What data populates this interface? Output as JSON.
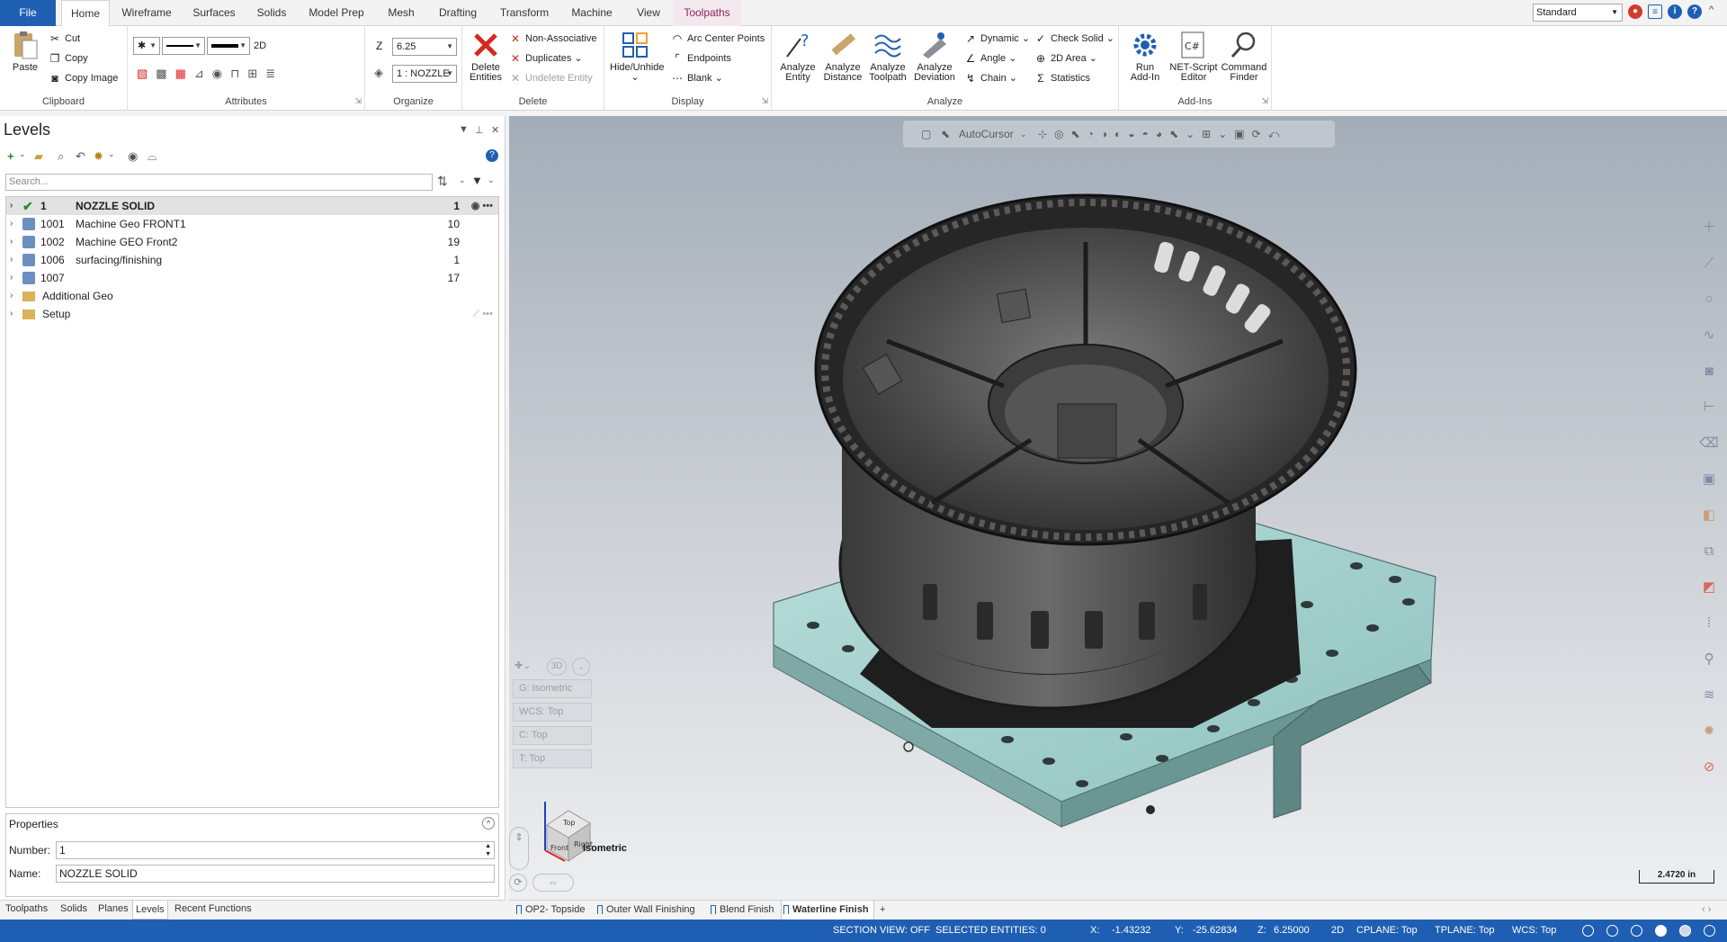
{
  "tabs": {
    "file": "File",
    "home": "Home",
    "wireframe": "Wireframe",
    "surfaces": "Surfaces",
    "solids": "Solids",
    "model_prep": "Model Prep",
    "mesh": "Mesh",
    "drafting": "Drafting",
    "transform": "Transform",
    "machine": "Machine",
    "view": "View",
    "toolpaths": "Toolpaths"
  },
  "workspace": "Standard",
  "clipboard": {
    "paste": "Paste",
    "cut": "Cut",
    "copy": "Copy",
    "copy_image": "Copy Image",
    "label": "Clipboard"
  },
  "attributes": {
    "mode_2d": "2D",
    "label": "Attributes"
  },
  "organize": {
    "z_label": "Z",
    "z_value": "6.25",
    "level_value": "1 : NOZZLE",
    "label": "Organize"
  },
  "delete_group": {
    "delete_entities_1": "Delete",
    "delete_entities_2": "Entities",
    "non_associative": "Non-Associative",
    "duplicates": "Duplicates",
    "undelete_entity": "Undelete Entity",
    "label": "Delete"
  },
  "display": {
    "hide_unhide_1": "Hide/Unhide",
    "arc_center_points": "Arc Center Points",
    "endpoints": "Endpoints",
    "blank": "Blank",
    "label": "Display"
  },
  "analyze": {
    "analyze_entity_1": "Analyze",
    "analyze_entity_2": "Entity",
    "analyze_distance_1": "Analyze",
    "analyze_distance_2": "Distance",
    "analyze_toolpath_1": "Analyze",
    "analyze_toolpath_2": "Toolpath",
    "analyze_deviation_1": "Analyze",
    "analyze_deviation_2": "Deviation",
    "dynamic": "Dynamic",
    "angle": "Angle",
    "chain": "Chain",
    "check_solid": "Check Solid",
    "area_2d": "2D Area",
    "statistics": "Statistics",
    "label": "Analyze"
  },
  "addins": {
    "run_addin_1": "Run",
    "run_addin_2": "Add-In",
    "net_script_1": "NET-Script",
    "net_script_2": "Editor",
    "command_finder_1": "Command",
    "command_finder_2": "Finder",
    "label": "Add-Ins"
  },
  "levels": {
    "title": "Levels",
    "search_placeholder": "Search...",
    "rows": [
      {
        "num": "1",
        "name": "NOZZLE SOLID",
        "count": "1"
      },
      {
        "num": "1001",
        "name": "Machine Geo FRONT1",
        "count": "10"
      },
      {
        "num": "1002",
        "name": "Machine GEO Front2",
        "count": "19"
      },
      {
        "num": "1006",
        "name": "surfacing/finishing",
        "count": "1"
      },
      {
        "num": "1007",
        "name": "",
        "count": "17"
      },
      {
        "num": "",
        "name": "Additional Geo",
        "count": ""
      },
      {
        "num": "",
        "name": "Setup",
        "count": ""
      }
    ]
  },
  "properties": {
    "title": "Properties",
    "number_label": "Number:",
    "number_value": "1",
    "name_label": "Name:",
    "name_value": "NOZZLE SOLID"
  },
  "panel_tabs": [
    "Toolpaths",
    "Solids",
    "Planes",
    "Levels",
    "Recent Functions"
  ],
  "viewport": {
    "autocursor": "AutoCursor",
    "qv_3d": "3D",
    "qv_g": "G: Isometric",
    "qv_wcs": "WCS: Top",
    "qv_c": "C: Top",
    "qv_t": "T: Top",
    "view_label": "Isometric",
    "scale": "2.4720 in",
    "viewcube_top": "Top",
    "viewcube_front": "Front",
    "viewcube_right": "Right"
  },
  "view_tabs": [
    "OP2- Topside",
    "Outer Wall Finishing",
    "Blend Finish",
    "Waterline Finish"
  ],
  "status": {
    "section_view": "SECTION VIEW: OFF",
    "selected": "SELECTED ENTITIES: 0",
    "x_label": "X:",
    "x_value": "-1.43232",
    "y_label": "Y:",
    "y_value": "-25.62834",
    "z_label": "Z:",
    "z_value": "6.25000",
    "mode": "2D",
    "cplane": "CPLANE: Top",
    "tplane": "TPLANE: Top",
    "wcs": "WCS: Top"
  },
  "colors": {
    "accent": "#1f5fb3",
    "contextual_tab": "#8a2457",
    "fixture": "#a9d4d1",
    "part": "#4a4a4a"
  }
}
